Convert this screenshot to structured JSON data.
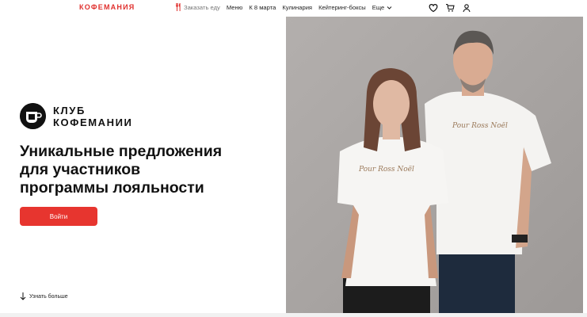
{
  "header": {
    "logo": "КОФЕМАНИЯ",
    "nav": [
      {
        "label": "Заказать еду",
        "icon": "fork-knife-icon"
      },
      {
        "label": "Меню"
      },
      {
        "label": "К 8 марта"
      },
      {
        "label": "Кулинария"
      },
      {
        "label": "Кейтеринг-боксы"
      },
      {
        "label": "Еще",
        "icon": "chevron-down-icon"
      }
    ],
    "icons": [
      "heart-icon",
      "cart-icon",
      "user-icon"
    ]
  },
  "hero": {
    "club_line1": "КЛУБ",
    "club_line2": "КОФЕМАНИИ",
    "headline_line1": "Уникальные предложения",
    "headline_line2": "для участников",
    "headline_line3": "программы лояльности",
    "login_label": "Войти",
    "learn_more_label": "Узнать больше",
    "shirt_text": "Pour Ross Noël"
  },
  "colors": {
    "brand": "#e0312e",
    "button": "#e7352f",
    "photo_bg": "#a8a4a2"
  }
}
